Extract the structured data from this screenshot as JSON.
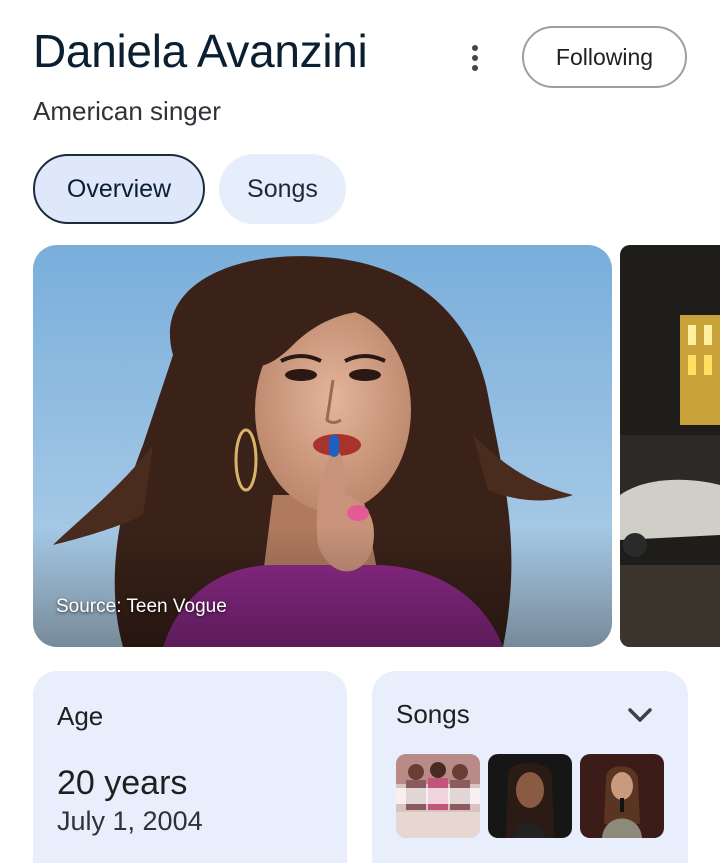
{
  "header": {
    "title": "Daniela Avanzini",
    "subtitle": "American singer",
    "follow_label": "Following",
    "more_icon": "more-vert-icon"
  },
  "tabs": [
    {
      "label": "Overview",
      "selected": true
    },
    {
      "label": "Songs",
      "selected": false
    }
  ],
  "media": {
    "main_image_source": "Source: Teen Vogue"
  },
  "cards": {
    "age": {
      "label": "Age",
      "value": "20 years",
      "date": "July 1, 2004"
    },
    "songs": {
      "label": "Songs",
      "expand_icon": "chevron-down-icon"
    }
  },
  "colors": {
    "chip_selected_bg": "#dfe7fb",
    "chip_bg": "#e6edfb",
    "card_bg": "#e8eefb",
    "title_text": "#0b1f33"
  }
}
